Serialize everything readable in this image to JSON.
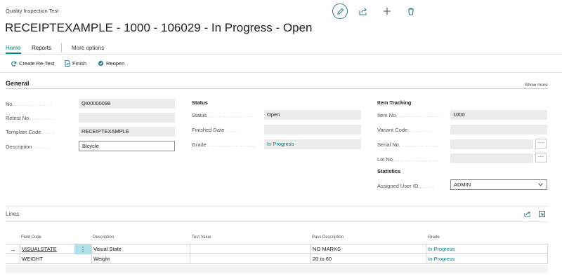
{
  "page": {
    "caption": "Quality Inspection Test",
    "title": "RECEIPTEXAMPLE - 1000 - 106029 - In Progress - Open"
  },
  "top_icons": [
    "edit-pencil-icon",
    "share-icon",
    "add-icon",
    "delete-icon"
  ],
  "tabs": {
    "home": "Home",
    "reports": "Reports",
    "more": "More options"
  },
  "actions": {
    "create_retest": "Create Re-Test",
    "finish": "Finish",
    "reopen": "Reopen"
  },
  "general": {
    "title": "General",
    "show_more": "Show more",
    "no_label": "No.",
    "no_value": "QI00000098",
    "retest_label": "Retest No.",
    "retest_value": "",
    "template_label": "Template Code",
    "template_value": "RECEIPTEXAMPLE",
    "description_label": "Description",
    "description_value": "Bicycle"
  },
  "status": {
    "heading": "Status",
    "status_label": "Status",
    "status_value": "Open",
    "finished_label": "Finished Date",
    "finished_value": "",
    "grade_label": "Grade",
    "grade_value": "In Progress"
  },
  "tracking": {
    "heading": "Item Tracking",
    "item_label": "Item No.",
    "item_value": "1000",
    "variant_label": "Variant Code",
    "variant_value": "",
    "serial_label": "Serial No.",
    "serial_value": "",
    "lot_label": "Lot No.",
    "lot_value": ""
  },
  "statistics": {
    "heading": "Statistics",
    "assigned_label": "Assigned User ID",
    "assigned_value": "ADMIN"
  },
  "lines": {
    "title": "Lines",
    "columns": {
      "field_code": "Field Code",
      "description": "Description",
      "test_value": "Test Value",
      "pass_description": "Pass Description",
      "grade": "Grade"
    },
    "rows": [
      {
        "field_code": "VISUALSTATE",
        "description": "Visual State",
        "test_value": "",
        "pass_description": "NO MARKS",
        "grade": "In Progress"
      },
      {
        "field_code": "WEIGHT",
        "description": "Weight",
        "test_value": "",
        "pass_description": "20 to 60",
        "grade": "In Progress"
      }
    ]
  },
  "colors": {
    "accent": "#00838f",
    "field_bg": "#ebebeb",
    "selected_cell": "#b2e0ea"
  }
}
